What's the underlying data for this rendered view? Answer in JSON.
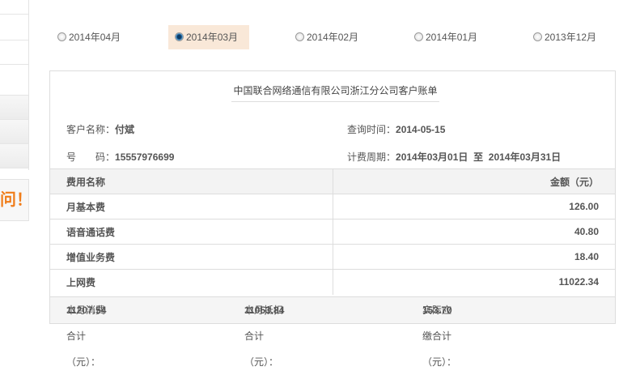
{
  "sidebar": {
    "notice": "问！"
  },
  "months": [
    {
      "label": "2014年04月",
      "selected": false
    },
    {
      "label": "2014年03月",
      "selected": true
    },
    {
      "label": "2014年02月",
      "selected": false
    },
    {
      "label": "2014年01月",
      "selected": false
    },
    {
      "label": "2013年12月",
      "selected": false
    }
  ],
  "bill": {
    "title": "中国联合网络通信有限公司浙江分公司客户账单",
    "customer_label": "客户名称：",
    "customer": "付斌",
    "query_label": "查询时间：",
    "query_time": "2014-05-15",
    "number_label": "号　　码：",
    "number": "15557976699",
    "period_label": "计费周期：",
    "period_start": "2014年03月01日",
    "period_to": "至",
    "period_end": "2014年03月31日",
    "header": {
      "name": "费用名称",
      "amount": "金额（元）"
    },
    "rows": [
      {
        "name": "月基本费",
        "amount": "126.00"
      },
      {
        "name": "语音通话费",
        "amount": "40.80"
      },
      {
        "name": "增值业务费",
        "amount": "18.40"
      },
      {
        "name": "上网费",
        "amount": "11022.34"
      }
    ],
    "totals": {
      "consume_label": "本月消费合计（元）：",
      "consume": "11207.54",
      "deduct_label": "本月抵扣合计（元）：",
      "deduct": "11053.84",
      "due_label": "实际应缴合计（元）：",
      "due": "153.70"
    }
  }
}
